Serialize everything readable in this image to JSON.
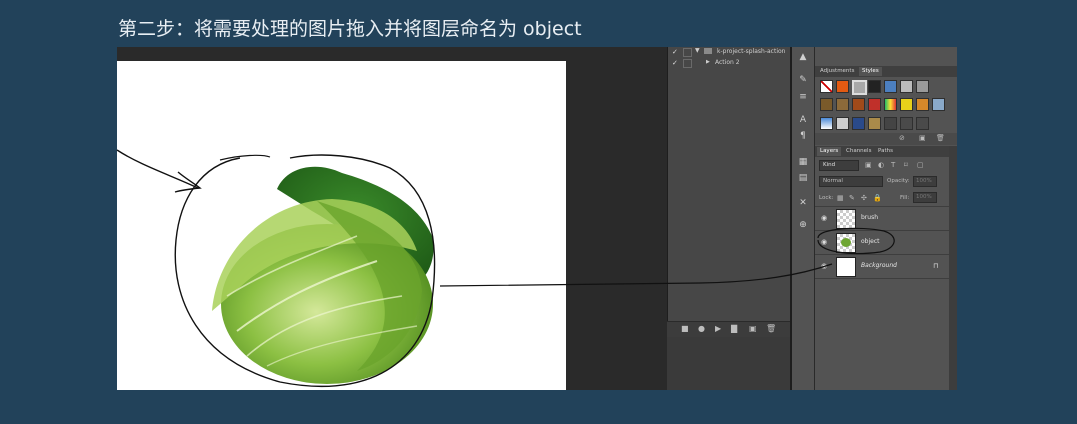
{
  "heading": "第二步：将需要处理的图片拖入并将图层命名为 object",
  "actions_panel": {
    "rows": [
      "k-project-splash-action",
      "Action 2"
    ]
  },
  "panel_tabs": {
    "top": [
      "Adjustments",
      "Styles"
    ],
    "layers": [
      "Layers",
      "Channels",
      "Paths"
    ]
  },
  "layers_panel": {
    "filter_kind": "Kind",
    "blend_mode": "Normal",
    "opacity_label": "Opacity:",
    "opacity_value": "100%",
    "lock_label": "Lock:",
    "fill_label": "Fill:",
    "fill_value": "100%",
    "layers": [
      {
        "name": "brush"
      },
      {
        "name": "object"
      },
      {
        "name": "Background"
      }
    ]
  },
  "icons": [
    "check-icon",
    "triangle-expand-icon",
    "folder-icon",
    "eye-icon",
    "lock-icon",
    "trash-icon",
    "play-icon",
    "record-icon",
    "stop-icon",
    "new-icon"
  ],
  "colors": {
    "background": "#22425a",
    "panel": "#535353",
    "canvas": "#ffffff",
    "cabbage": "#7fb23a"
  }
}
